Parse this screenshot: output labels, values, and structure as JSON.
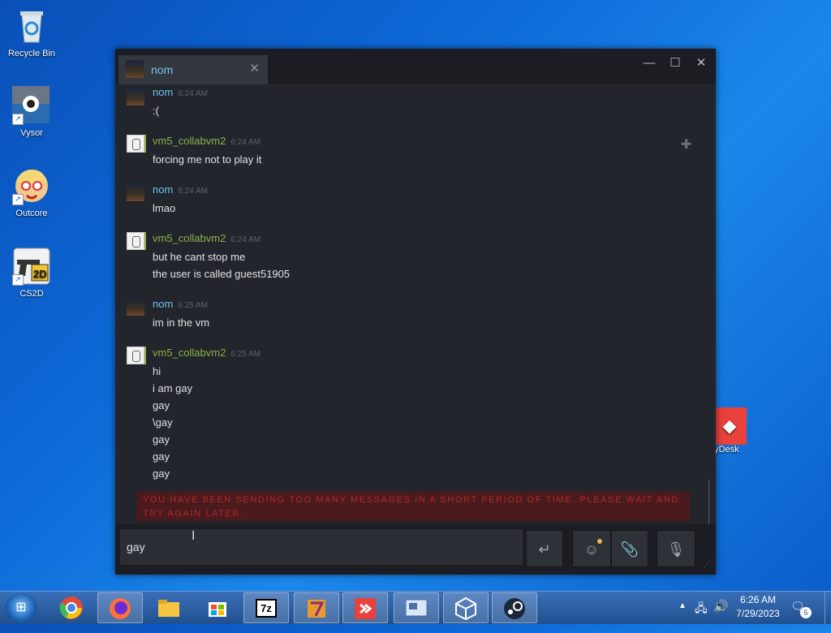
{
  "desktop": {
    "icons": [
      {
        "label": "Recycle Bin"
      },
      {
        "label": "Vysor"
      },
      {
        "label": "Outcore"
      },
      {
        "label": "CS2D"
      }
    ],
    "anydesk_label": "nyDesk"
  },
  "chat": {
    "tab_name": "nom",
    "messages": [
      {
        "user": "nom",
        "time": "6:24 AM",
        "lines": [
          ":("
        ]
      },
      {
        "user": "vm5_collabvm2",
        "time": "6:24 AM",
        "lines": [
          "forcing me not to play it"
        ]
      },
      {
        "user": "nom",
        "time": "6:24 AM",
        "lines": [
          "lmao"
        ]
      },
      {
        "user": "vm5_collabvm2",
        "time": "6:24 AM",
        "lines": [
          "but he cant stop me",
          "the user is called guest51905"
        ]
      },
      {
        "user": "nom",
        "time": "6:25 AM",
        "lines": [
          "im in the vm"
        ]
      },
      {
        "user": "vm5_collabvm2",
        "time": "6:25 AM",
        "lines": [
          "hi",
          "i am gay",
          "gay",
          "\\gay",
          "gay",
          "gay",
          "gay"
        ]
      }
    ],
    "rate_limit_text": "YOU HAVE BEEN SENDING TOO MANY MESSAGES IN A SHORT PERIOD OF TIME. PLEASE WAIT AND TRY AGAIN LATER.",
    "input_value": "gay"
  },
  "taskbar": {
    "apps": [
      "chrome-icon",
      "firefox-icon",
      "file-explorer-icon",
      "store-icon",
      "7zip-icon",
      "winrar-icon",
      "anydesk-icon",
      "vm-icon",
      "unity-icon",
      "steam-icon"
    ],
    "sevenzip_label": "7z",
    "clock_time": "6:26 AM",
    "clock_date": "7/29/2023",
    "notification_count": "5"
  }
}
